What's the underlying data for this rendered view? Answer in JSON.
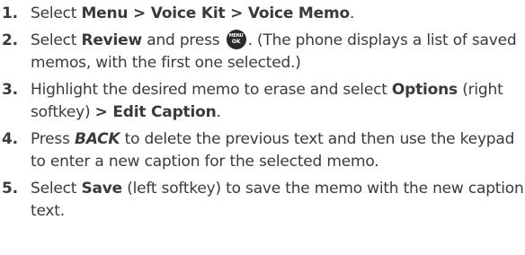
{
  "steps": [
    {
      "number": "1.",
      "t1": "Select ",
      "b1": "Menu > Voice Kit > Voice Memo",
      "t2": "."
    },
    {
      "number": "2.",
      "t1": "Select ",
      "b1": "Review",
      "t2": " and press ",
      "key_top": "MENU",
      "key_bottom": "OK",
      "t3": ". (The phone displays a list of saved memos, with the first one selected.)"
    },
    {
      "number": "3.",
      "t1": "Highlight the desired memo to erase and select ",
      "b1": "Options",
      "t2": " (right softkey) ",
      "b2": "> Edit Caption",
      "t3": "."
    },
    {
      "number": "4.",
      "t1": "Press ",
      "b1": "BACK",
      "t2": " to delete the previous text and then use the keypad to enter a new caption for the selected memo."
    },
    {
      "number": "5.",
      "t1": "Select ",
      "b1": "Save",
      "t2": " (left softkey) to save the memo with the new caption text."
    }
  ]
}
